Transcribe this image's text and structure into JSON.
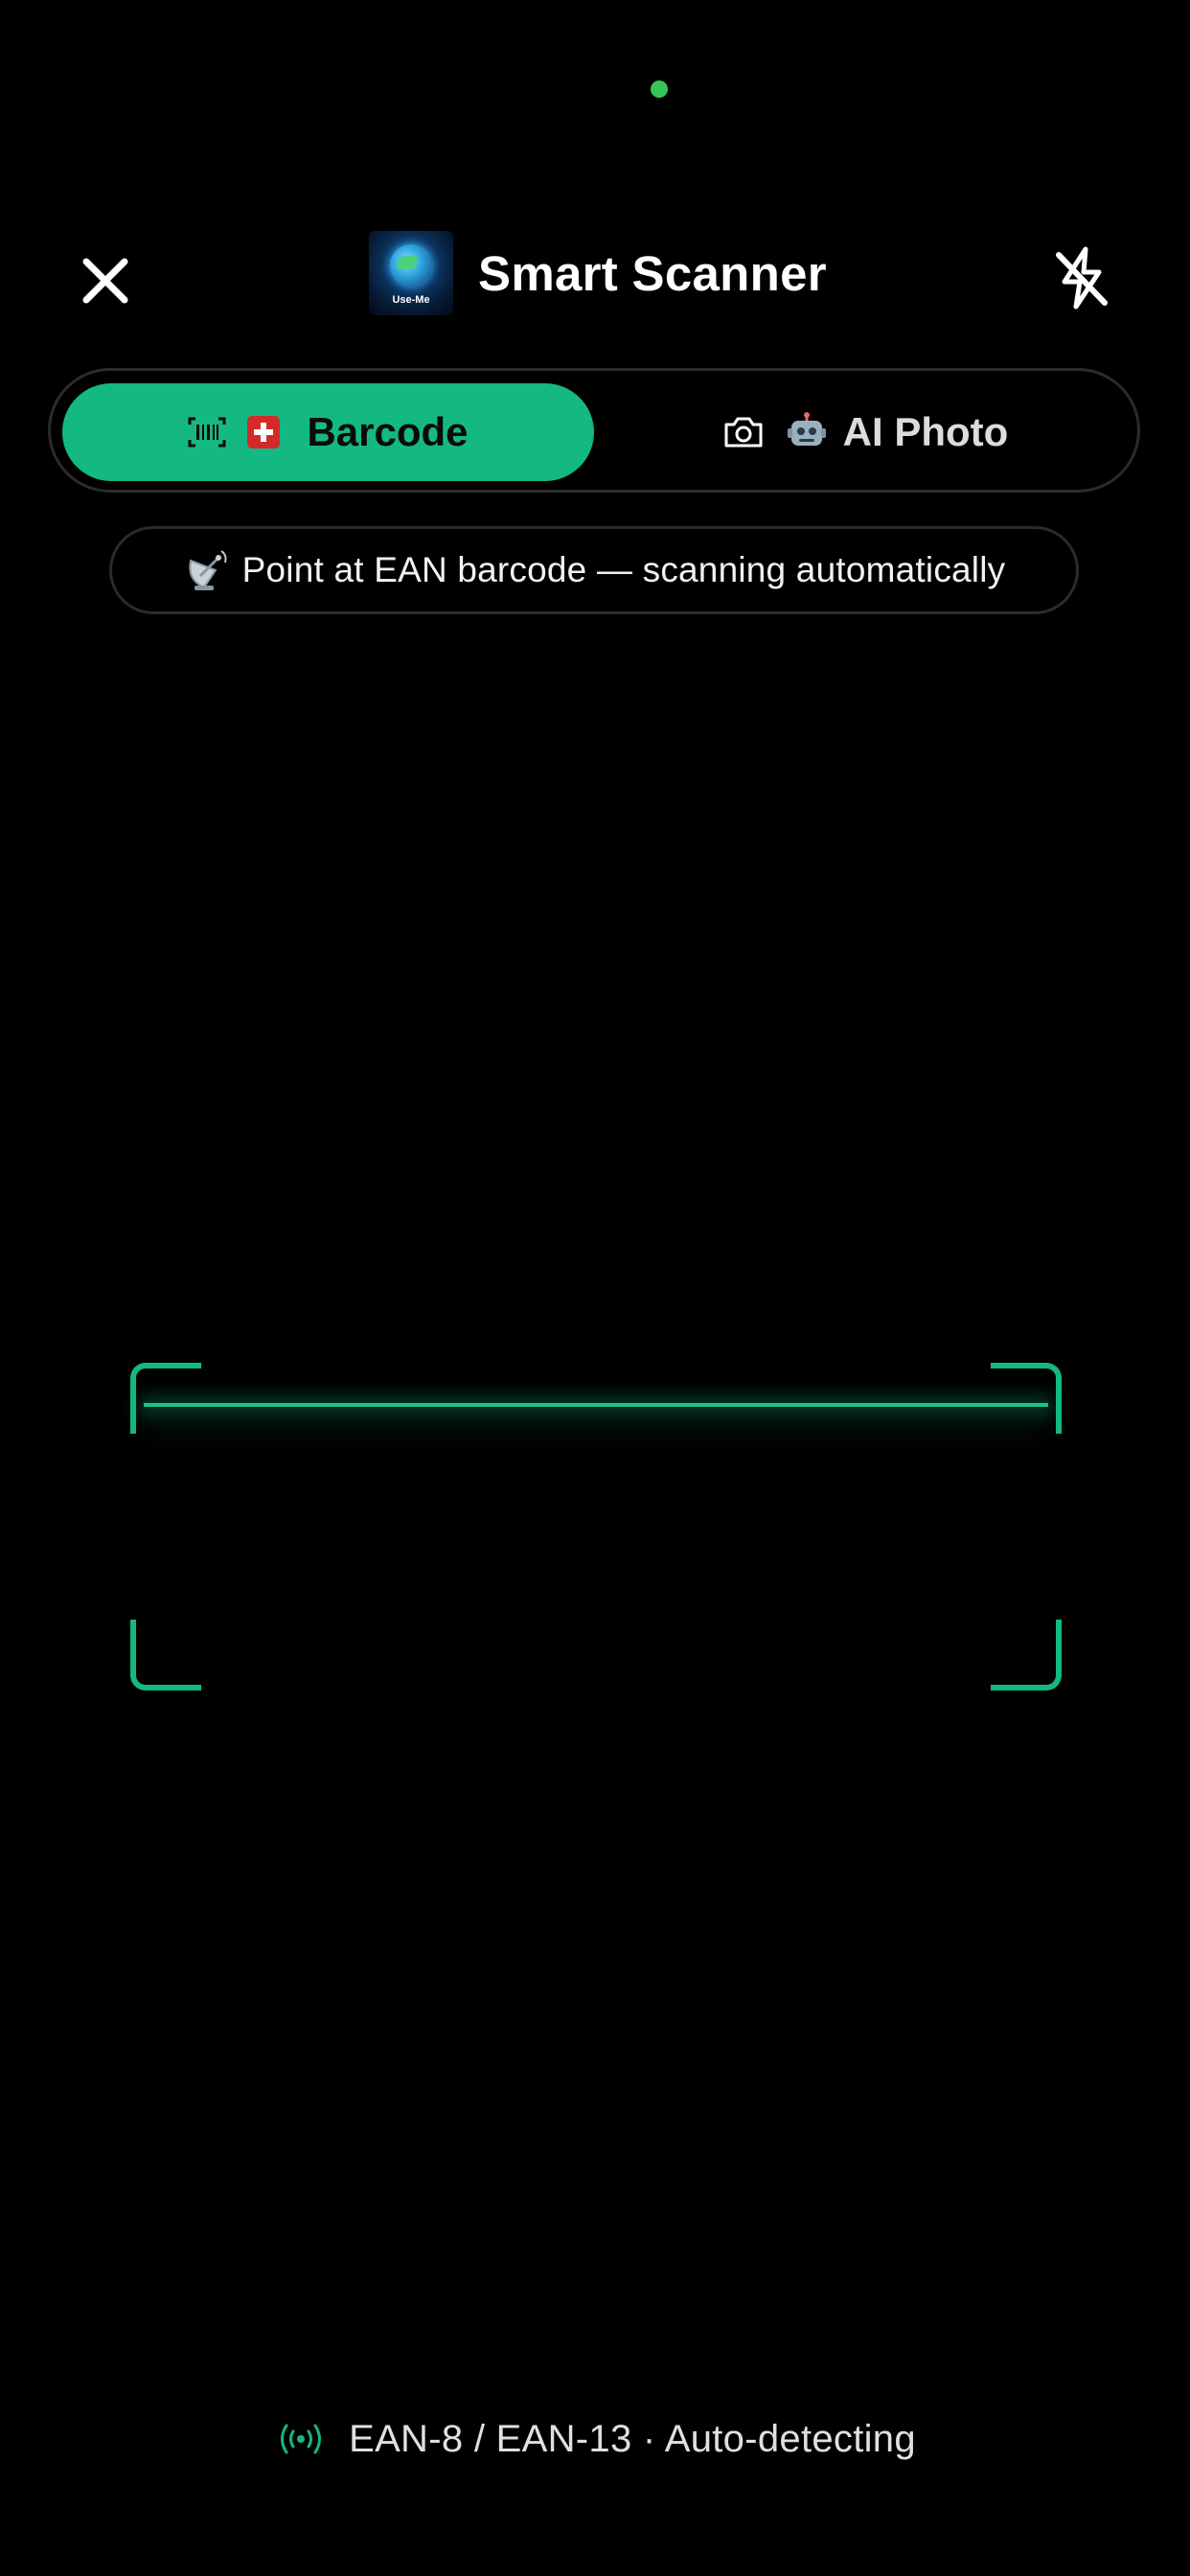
{
  "header": {
    "title": "Smart Scanner",
    "logo_text": "Use-Me",
    "close_icon": "close-icon",
    "flash_icon": "flash-off-icon"
  },
  "mode_toggle": {
    "barcode": {
      "label": "Barcode",
      "icon": "barcode-icon",
      "emoji": "swiss-flag-emoji",
      "selected": true
    },
    "ai_photo": {
      "label": "AI Photo",
      "icon": "camera-icon",
      "emoji": "robot-emoji",
      "selected": false
    }
  },
  "hint": {
    "icon": "satellite-dish-icon",
    "text": "Point at EAN barcode — scanning automatically"
  },
  "footer": {
    "icon": "broadcast-icon",
    "text": "EAN-8 / EAN-13 · Auto-detecting"
  },
  "colors": {
    "accent": "#14b883",
    "background": "#000000",
    "camera_indicator": "#34c759"
  }
}
